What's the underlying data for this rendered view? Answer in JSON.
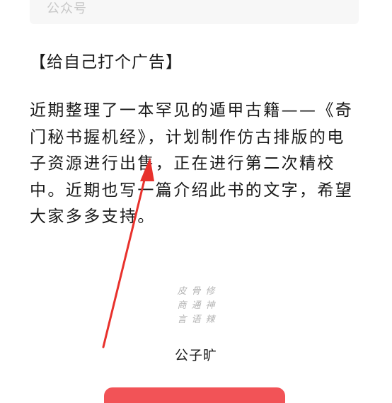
{
  "search": {
    "placeholder": "公众号"
  },
  "article": {
    "heading": "【给自己打个广告】",
    "paragraph_lines": [
      "近期整理了一本罕见的遁甲古籍——《奇",
      "门秘书握机经》，计划制作仿古排版的电",
      "子资源进行出售，正在进行第二次精校",
      "中。近期也写一篇介绍此书的文字，希望",
      "大家多多支持。"
    ]
  },
  "seal": {
    "chars": [
      "皮",
      "骨",
      "修",
      "商",
      "通",
      "神",
      "言",
      "语",
      "辣"
    ]
  },
  "author": {
    "name": "公子旷"
  },
  "colors": {
    "arrow": "#e8312c",
    "button": "#f25357",
    "text": "#1a1a1a",
    "placeholder": "#c8c8c8"
  }
}
